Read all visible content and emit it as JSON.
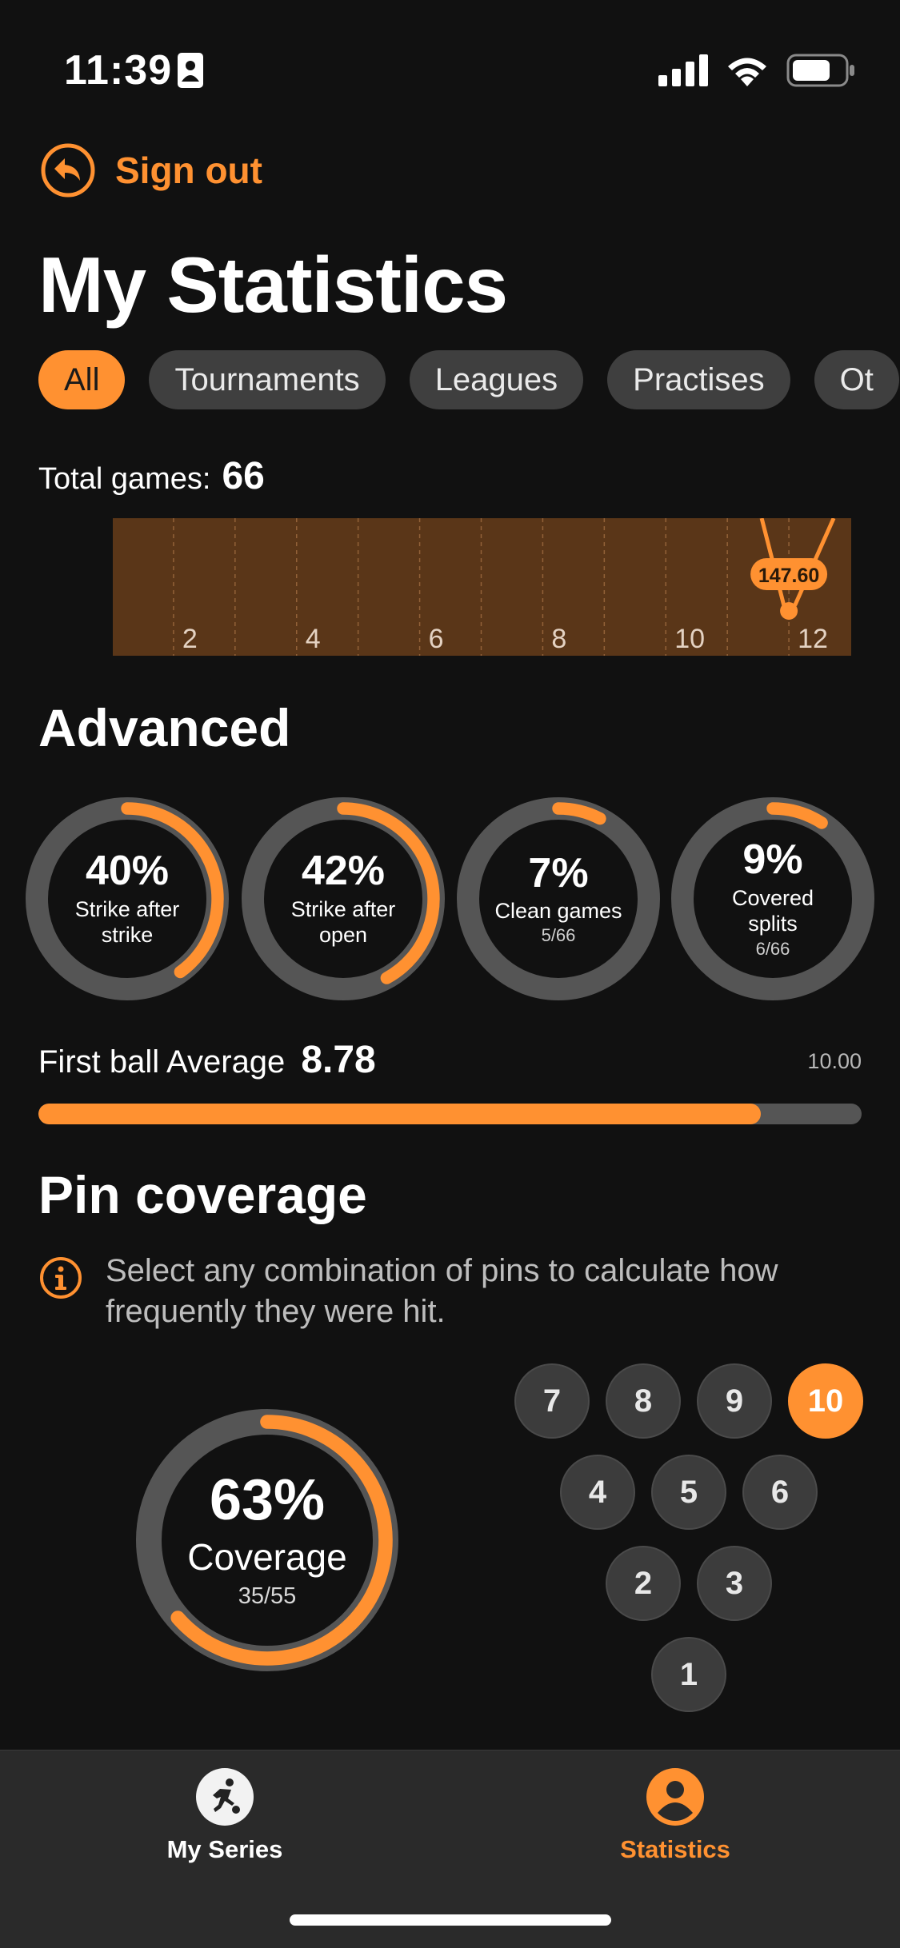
{
  "status_bar": {
    "time": "11:39"
  },
  "header": {
    "sign_out_label": "Sign out",
    "title": "My Statistics"
  },
  "filters": {
    "items": [
      "All",
      "Tournaments",
      "Leagues",
      "Practises",
      "Ot"
    ],
    "selected": "All"
  },
  "summary": {
    "total_games_label": "Total games:",
    "total_games_value": "66"
  },
  "chart_data": {
    "type": "line",
    "title": "",
    "xlabel": "",
    "ylabel": "",
    "x_ticks": [
      "2",
      "4",
      "6",
      "8",
      "10",
      "12"
    ],
    "xlim": [
      1,
      13
    ],
    "highlight": {
      "x": 12,
      "label": "147.60"
    },
    "grid": "vertical dashed"
  },
  "advanced": {
    "title": "Advanced",
    "rings": [
      {
        "percent": "40%",
        "label": "Strike after strike",
        "sub": "",
        "fraction": 0.4
      },
      {
        "percent": "42%",
        "label": "Strike after open",
        "sub": "",
        "fraction": 0.42
      },
      {
        "percent": "7%",
        "label": "Clean games",
        "sub": "5/66",
        "fraction": 0.076
      },
      {
        "percent": "9%",
        "label": "Covered splits",
        "sub": "6/66",
        "fraction": 0.091
      }
    ]
  },
  "first_ball": {
    "label": "First ball Average",
    "value": "8.78",
    "max": "10.00",
    "fraction": 0.878
  },
  "pin_coverage": {
    "title": "Pin coverage",
    "info": "Select any combination of pins to calculate how frequently they were hit.",
    "percent": "63%",
    "label": "Coverage",
    "sub": "35/55",
    "fraction": 0.636,
    "pins": [
      "7",
      "8",
      "9",
      "10",
      "4",
      "5",
      "6",
      "2",
      "3",
      "1"
    ],
    "selected_pins": [
      "10"
    ]
  },
  "tabbar": {
    "series_label": "My Series",
    "stats_label": "Statistics",
    "active": "Statistics"
  },
  "colors": {
    "accent": "#ff9131",
    "background": "#111111",
    "track": "#555555",
    "chart_bg": "#5a3618"
  }
}
